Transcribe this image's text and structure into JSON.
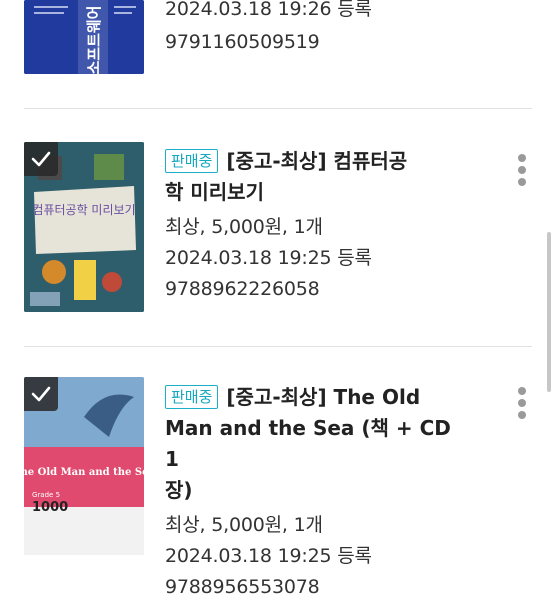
{
  "items": [
    {
      "date_line": "2024.03.18 19:26 등록",
      "isbn": "9791160509519",
      "cover_title": "소프트웨어"
    },
    {
      "badge": "판매중",
      "title_l1": "[중고-최상] 컴퓨터공",
      "title_l2": "학 미리보기",
      "price_line": "최상, 5,000원, 1개",
      "date_line": "2024.03.18 19:25 등록",
      "isbn": "9788962226058",
      "cover_title": "컴퓨터공학 미리보기"
    },
    {
      "badge": "판매중",
      "title_l1": "[중고-최상] The Old",
      "title_l2": "Man and the Sea (책 + CD 1",
      "title_l3": "장)",
      "price_line": "최상, 5,000원, 1개",
      "date_line": "2024.03.18 19:25 등록",
      "isbn": "9788956553078",
      "cover_title": "The Old Man and the Sea",
      "cover_grade": "Grade 5",
      "cover_words": "1000"
    }
  ],
  "colors": {
    "badge": "#17a8c0",
    "divider": "#e1e1e1",
    "kebab": "#9a9a9a"
  },
  "icons": {
    "more": "more-vertical-icon",
    "check": "checkmark-icon"
  }
}
